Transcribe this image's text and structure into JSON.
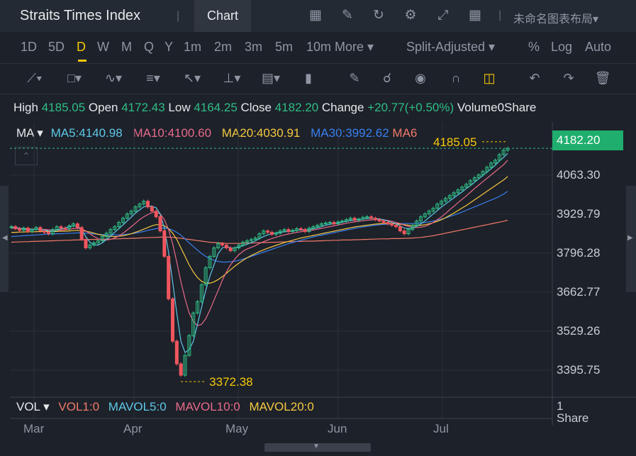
{
  "app": {
    "title": "Straits Times Index",
    "tab": "Chart",
    "layout_name": "未命名图表布局▾"
  },
  "periods": [
    "1D",
    "5D",
    "D",
    "W",
    "M",
    "Q",
    "Y",
    "1m",
    "2m",
    "3m",
    "5m",
    "10m",
    "More ▾"
  ],
  "active_period": "D",
  "adjustment": "Split-Adjusted ▾",
  "options": [
    "%",
    "Log",
    "Auto"
  ],
  "toolbar_icons": [
    "chart-settings-icon",
    "draw-icon",
    "refresh-icon",
    "gear-icon",
    "fullscreen-icon",
    "grid-layout-icon"
  ],
  "draw_tools": [
    "line-tool-icon",
    "rectangle-tool-icon",
    "pattern-tool-icon",
    "fibonacci-tool-icon",
    "arrow-tool-icon",
    "measure-tool-icon",
    "text-tool-icon",
    "indicator-icon",
    "pencil-icon",
    "lock-icon",
    "visibility-icon",
    "magnet-icon",
    "link-icon",
    "undo-icon",
    "redo-icon",
    "trash-icon"
  ],
  "ohlc": {
    "high_label": "High",
    "high": "4185.05",
    "open_label": "Open",
    "open": "4172.43",
    "low_label": "Low",
    "low": "4164.25",
    "close_label": "Close",
    "close": "4182.20",
    "change_label": "Change",
    "change": "+20.77(+0.50%)",
    "volume_label": "Volume",
    "volume": "0Share"
  },
  "ma_legend": {
    "name": "MA ▾",
    "ma5": "MA5:4140.98",
    "ma10": "MA10:4100.60",
    "ma20": "MA20:4030.91",
    "ma30": "MA30:3992.62",
    "ma60": "MA6"
  },
  "price_axis": [
    "4063.30",
    "3929.79",
    "3796.28",
    "3662.77",
    "3529.26",
    "3395.75"
  ],
  "last_price": "4182.20",
  "high_marker": "4185.05",
  "low_marker": "3372.38",
  "vol_legend": {
    "name": "VOL ▾",
    "vol1": "VOL1:0",
    "mavol5": "MAVOL5:0",
    "mavol10": "MAVOL10:0",
    "mavol20": "MAVOL20:0"
  },
  "vol_axis": {
    "value": "1",
    "unit": "Share"
  },
  "months": [
    "Mar",
    "Apr",
    "May",
    "Jun",
    "Jul"
  ],
  "colors": {
    "up": "#2ebd85",
    "down": "#f0565e",
    "ma5": "#5ec8e8",
    "ma10": "#e86a8a",
    "ma20": "#f5c842",
    "ma30": "#3a7ff0",
    "ma60": "#f07a6a",
    "accent": "#f5c90a"
  },
  "chart_data": {
    "type": "candlestick",
    "ylim": [
      3340,
      4230
    ],
    "x_labels": [
      "Mar",
      "Apr",
      "May",
      "Jun",
      "Jul"
    ],
    "close": [
      3905,
      3898,
      3892,
      3900,
      3888,
      3895,
      3902,
      3890,
      3885,
      3880,
      3895,
      3905,
      3900,
      3898,
      3908,
      3915,
      3902,
      3860,
      3830,
      3840,
      3848,
      3855,
      3870,
      3882,
      3895,
      3905,
      3920,
      3935,
      3950,
      3960,
      3975,
      3985,
      3995,
      3975,
      3960,
      3940,
      3890,
      3800,
      3650,
      3500,
      3420,
      3380,
      3450,
      3520,
      3600,
      3640,
      3700,
      3760,
      3800,
      3830,
      3845,
      3840,
      3830,
      3820,
      3830,
      3840,
      3850,
      3855,
      3860,
      3865,
      3880,
      3890,
      3885,
      3878,
      3882,
      3890,
      3895,
      3888,
      3892,
      3898,
      3895,
      3888,
      3900,
      3905,
      3910,
      3915,
      3918,
      3920,
      3915,
      3922,
      3925,
      3930,
      3935,
      3928,
      3932,
      3938,
      3940,
      3935,
      3930,
      3925,
      3920,
      3915,
      3910,
      3905,
      3890,
      3880,
      3895,
      3910,
      3925,
      3940,
      3950,
      3960,
      3970,
      3985,
      3995,
      4005,
      4015,
      4025,
      4035,
      4045,
      4055,
      4068,
      4078,
      4088,
      4100,
      4115,
      4130,
      4140,
      4160,
      4175,
      4182
    ],
    "ma5": [
      3905,
      3902,
      3899,
      3897,
      3895,
      3894,
      3896,
      3895,
      3893,
      3890,
      3888,
      3893,
      3897,
      3900,
      3905,
      3908,
      3907,
      3893,
      3870,
      3850,
      3842,
      3840,
      3848,
      3860,
      3872,
      3885,
      3898,
      3911,
      3925,
      3939,
      3953,
      3964,
      3975,
      3978,
      3977,
      3972,
      3950,
      3900,
      3815,
      3710,
      3600,
      3500,
      3460,
      3470,
      3500,
      3560,
      3620,
      3680,
      3730,
      3770,
      3810,
      3830,
      3835,
      3830,
      3830,
      3833,
      3838,
      3843,
      3849,
      3855,
      3863,
      3870,
      3876,
      3880,
      3883,
      3885,
      3887,
      3888,
      3890,
      3892,
      3894,
      3893,
      3895,
      3898,
      3901,
      3905,
      3910,
      3913,
      3916,
      3918,
      3921,
      3924,
      3927,
      3928,
      3930,
      3932,
      3934,
      3935,
      3934,
      3932,
      3930,
      3925,
      3920,
      3915,
      3908,
      3900,
      3898,
      3900,
      3906,
      3915,
      3925,
      3938,
      3950,
      3962,
      3975,
      3985,
      3996,
      4007,
      4018,
      4028,
      4040,
      4050,
      4062,
      4074,
      4086,
      4098,
      4110,
      4122,
      4137,
      4150,
      4164
    ],
    "ma10": [
      3900,
      3900,
      3899,
      3898,
      3897,
      3896,
      3896,
      3896,
      3895,
      3894,
      3892,
      3892,
      3893,
      3894,
      3896,
      3898,
      3900,
      3897,
      3890,
      3880,
      3870,
      3862,
      3858,
      3858,
      3860,
      3865,
      3872,
      3882,
      3893,
      3905,
      3917,
      3930,
      3940,
      3948,
      3955,
      3958,
      3950,
      3930,
      3895,
      3845,
      3780,
      3710,
      3650,
      3600,
      3570,
      3555,
      3560,
      3580,
      3610,
      3645,
      3680,
      3715,
      3745,
      3770,
      3790,
      3806,
      3818,
      3826,
      3832,
      3838,
      3846,
      3852,
      3858,
      3863,
      3868,
      3872,
      3876,
      3879,
      3882,
      3885,
      3887,
      3889,
      3891,
      3893,
      3896,
      3899,
      3902,
      3905,
      3908,
      3911,
      3914,
      3917,
      3920,
      3922,
      3924,
      3926,
      3928,
      3929,
      3930,
      3930,
      3929,
      3927,
      3924,
      3920,
      3916,
      3910,
      3906,
      3903,
      3902,
      3903,
      3906,
      3912,
      3920,
      3930,
      3940,
      3952,
      3965,
      3977,
      3990,
      4002,
      4014,
      4027,
      4040,
      4052,
      4064,
      4076,
      4088,
      4100,
      4112,
      4124,
      4140
    ],
    "ma20": [
      3885,
      3885,
      3886,
      3886,
      3887,
      3887,
      3887,
      3888,
      3888,
      3888,
      3888,
      3888,
      3889,
      3889,
      3890,
      3891,
      3892,
      3891,
      3889,
      3886,
      3882,
      3878,
      3875,
      3872,
      3871,
      3870,
      3871,
      3873,
      3876,
      3880,
      3885,
      3890,
      3896,
      3902,
      3908,
      3912,
      3912,
      3908,
      3898,
      3882,
      3860,
      3830,
      3800,
      3770,
      3745,
      3725,
      3712,
      3705,
      3705,
      3710,
      3718,
      3728,
      3740,
      3753,
      3765,
      3776,
      3786,
      3795,
      3803,
      3810,
      3817,
      3823,
      3829,
      3834,
      3839,
      3844,
      3849,
      3853,
      3857,
      3861,
      3865,
      3868,
      3871,
      3874,
      3877,
      3880,
      3883,
      3886,
      3889,
      3892,
      3895,
      3898,
      3901,
      3904,
      3906,
      3908,
      3910,
      3912,
      3914,
      3915,
      3916,
      3916,
      3916,
      3915,
      3914,
      3912,
      3910,
      3909,
      3909,
      3910,
      3912,
      3915,
      3919,
      3924,
      3930,
      3937,
      3945,
      3953,
      3962,
      3971,
      3980,
      3990,
      4000,
      4010,
      4020,
      4030,
      4040,
      4050,
      4060,
      4070,
      4082
    ],
    "ma30": [
      3870,
      3871,
      3872,
      3873,
      3874,
      3875,
      3876,
      3877,
      3878,
      3879,
      3879,
      3880,
      3880,
      3881,
      3882,
      3882,
      3883,
      3883,
      3882,
      3881,
      3880,
      3878,
      3877,
      3876,
      3876,
      3876,
      3876,
      3877,
      3878,
      3880,
      3882,
      3885,
      3888,
      3892,
      3895,
      3898,
      3900,
      3900,
      3898,
      3893,
      3885,
      3875,
      3862,
      3848,
      3835,
      3822,
      3810,
      3800,
      3792,
      3786,
      3782,
      3780,
      3780,
      3781,
      3783,
      3786,
      3790,
      3795,
      3800,
      3805,
      3810,
      3815,
      3820,
      3825,
      3830,
      3835,
      3840,
      3845,
      3849,
      3853,
      3857,
      3861,
      3865,
      3869,
      3872,
      3875,
      3878,
      3881,
      3884,
      3887,
      3890,
      3893,
      3896,
      3899,
      3902,
      3904,
      3906,
      3908,
      3910,
      3912,
      3913,
      3914,
      3915,
      3916,
      3916,
      3916,
      3916,
      3916,
      3917,
      3918,
      3920,
      3922,
      3925,
      3928,
      3932,
      3936,
      3941,
      3946,
      3951,
      3957,
      3963,
      3969,
      3975,
      3981,
      3987,
      3993,
      3999,
      4005,
      4012,
      4020,
      4030
    ],
    "ma60": [
      3850,
      3851,
      3851,
      3852,
      3852,
      3853,
      3853,
      3854,
      3854,
      3855,
      3855,
      3856,
      3856,
      3857,
      3857,
      3858,
      3858,
      3859,
      3859,
      3860,
      3860,
      3860,
      3861,
      3861,
      3861,
      3862,
      3862,
      3863,
      3863,
      3864,
      3864,
      3865,
      3866,
      3866,
      3867,
      3867,
      3868,
      3868,
      3868,
      3867,
      3866,
      3864,
      3862,
      3860,
      3858,
      3856,
      3854,
      3852,
      3850,
      3849,
      3848,
      3847,
      3846,
      3846,
      3846,
      3846,
      3846,
      3847,
      3847,
      3848,
      3848,
      3849,
      3849,
      3850,
      3850,
      3851,
      3851,
      3852,
      3852,
      3853,
      3853,
      3854,
      3854,
      3854,
      3855,
      3855,
      3856,
      3856,
      3857,
      3857,
      3858,
      3858,
      3858,
      3859,
      3859,
      3860,
      3860,
      3861,
      3861,
      3862,
      3862,
      3862,
      3863,
      3863,
      3863,
      3864,
      3864,
      3865,
      3866,
      3867,
      3869,
      3871,
      3873,
      3876,
      3879,
      3882,
      3885,
      3888,
      3891,
      3894,
      3897,
      3900,
      3903,
      3906,
      3909,
      3912,
      3915,
      3918,
      3921,
      3924,
      3928
    ]
  }
}
